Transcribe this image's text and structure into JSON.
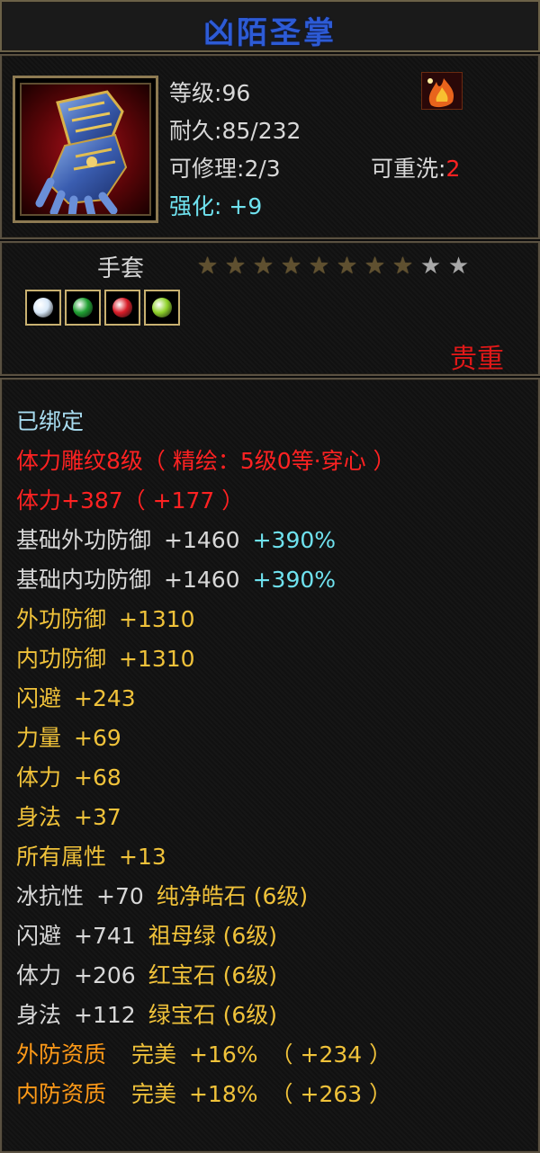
{
  "item": {
    "name": "凶陌圣掌",
    "level_label": "等级",
    "level_value": "96",
    "durability_label": "耐久",
    "durability_value": "85/232",
    "repair_label": "可修理",
    "repair_value": "2/3",
    "rewash_label": "可重洗",
    "rewash_value": "2",
    "enhance_label": "强化",
    "enhance_value": "+9",
    "type": "手套",
    "rarity": "贵重",
    "stars_filled": 8,
    "stars_total": 10,
    "gems": [
      {
        "icon": "white-gem-icon",
        "color": "#d8e8f8"
      },
      {
        "icon": "green-gem-icon",
        "color": "#1fa032"
      },
      {
        "icon": "red-gem-icon",
        "color": "#d81c28"
      },
      {
        "icon": "light-green-gem-icon",
        "color": "#8fd22a"
      }
    ]
  },
  "attributes": {
    "bound": "已绑定",
    "engrave": "体力雕纹8级（ 精绘：5级0等·穿心 ）",
    "stamina_total_main": "体力+387",
    "stamina_total_bonus": "（ +177 ）",
    "base_outer_def_label": "基础外功防御",
    "base_outer_def_value": "+1460",
    "base_outer_def_pct": "+390%",
    "base_inner_def_label": "基础内功防御",
    "base_inner_def_value": "+1460",
    "base_inner_def_pct": "+390%",
    "outer_def_label": "外功防御",
    "outer_def_value": "+1310",
    "inner_def_label": "内功防御",
    "inner_def_value": "+1310",
    "dodge_label": "闪避",
    "dodge_value": "+243",
    "strength_label": "力量",
    "strength_value": "+69",
    "stamina_label": "体力",
    "stamina_value": "+68",
    "agility_label": "身法",
    "agility_value": "+37",
    "all_attr_label": "所有属性",
    "all_attr_value": "+13",
    "gem_lines": [
      {
        "label": "冰抗性",
        "value": "+70",
        "gem": "纯净皓石 (6级)"
      },
      {
        "label": "闪避",
        "value": "+741",
        "gem": "祖母绿 (6级)"
      },
      {
        "label": "体力",
        "value": "+206",
        "gem": "红宝石 (6级)"
      },
      {
        "label": "身法",
        "value": "+112",
        "gem": "绿宝石 (6级)"
      }
    ],
    "quality_lines": [
      {
        "label": "外防资质",
        "grade": "完美",
        "pct": "+16%",
        "bonus": "（ +234 ）"
      },
      {
        "label": "内防资质",
        "grade": "完美",
        "pct": "+18%",
        "bonus": "（ +263 ）"
      }
    ]
  },
  "colors": {
    "title": "#2d5bd6",
    "red": "#ff2222",
    "cyan": "#6fe2ef",
    "yellow": "#f0c23a",
    "white": "#d8d8d8"
  }
}
